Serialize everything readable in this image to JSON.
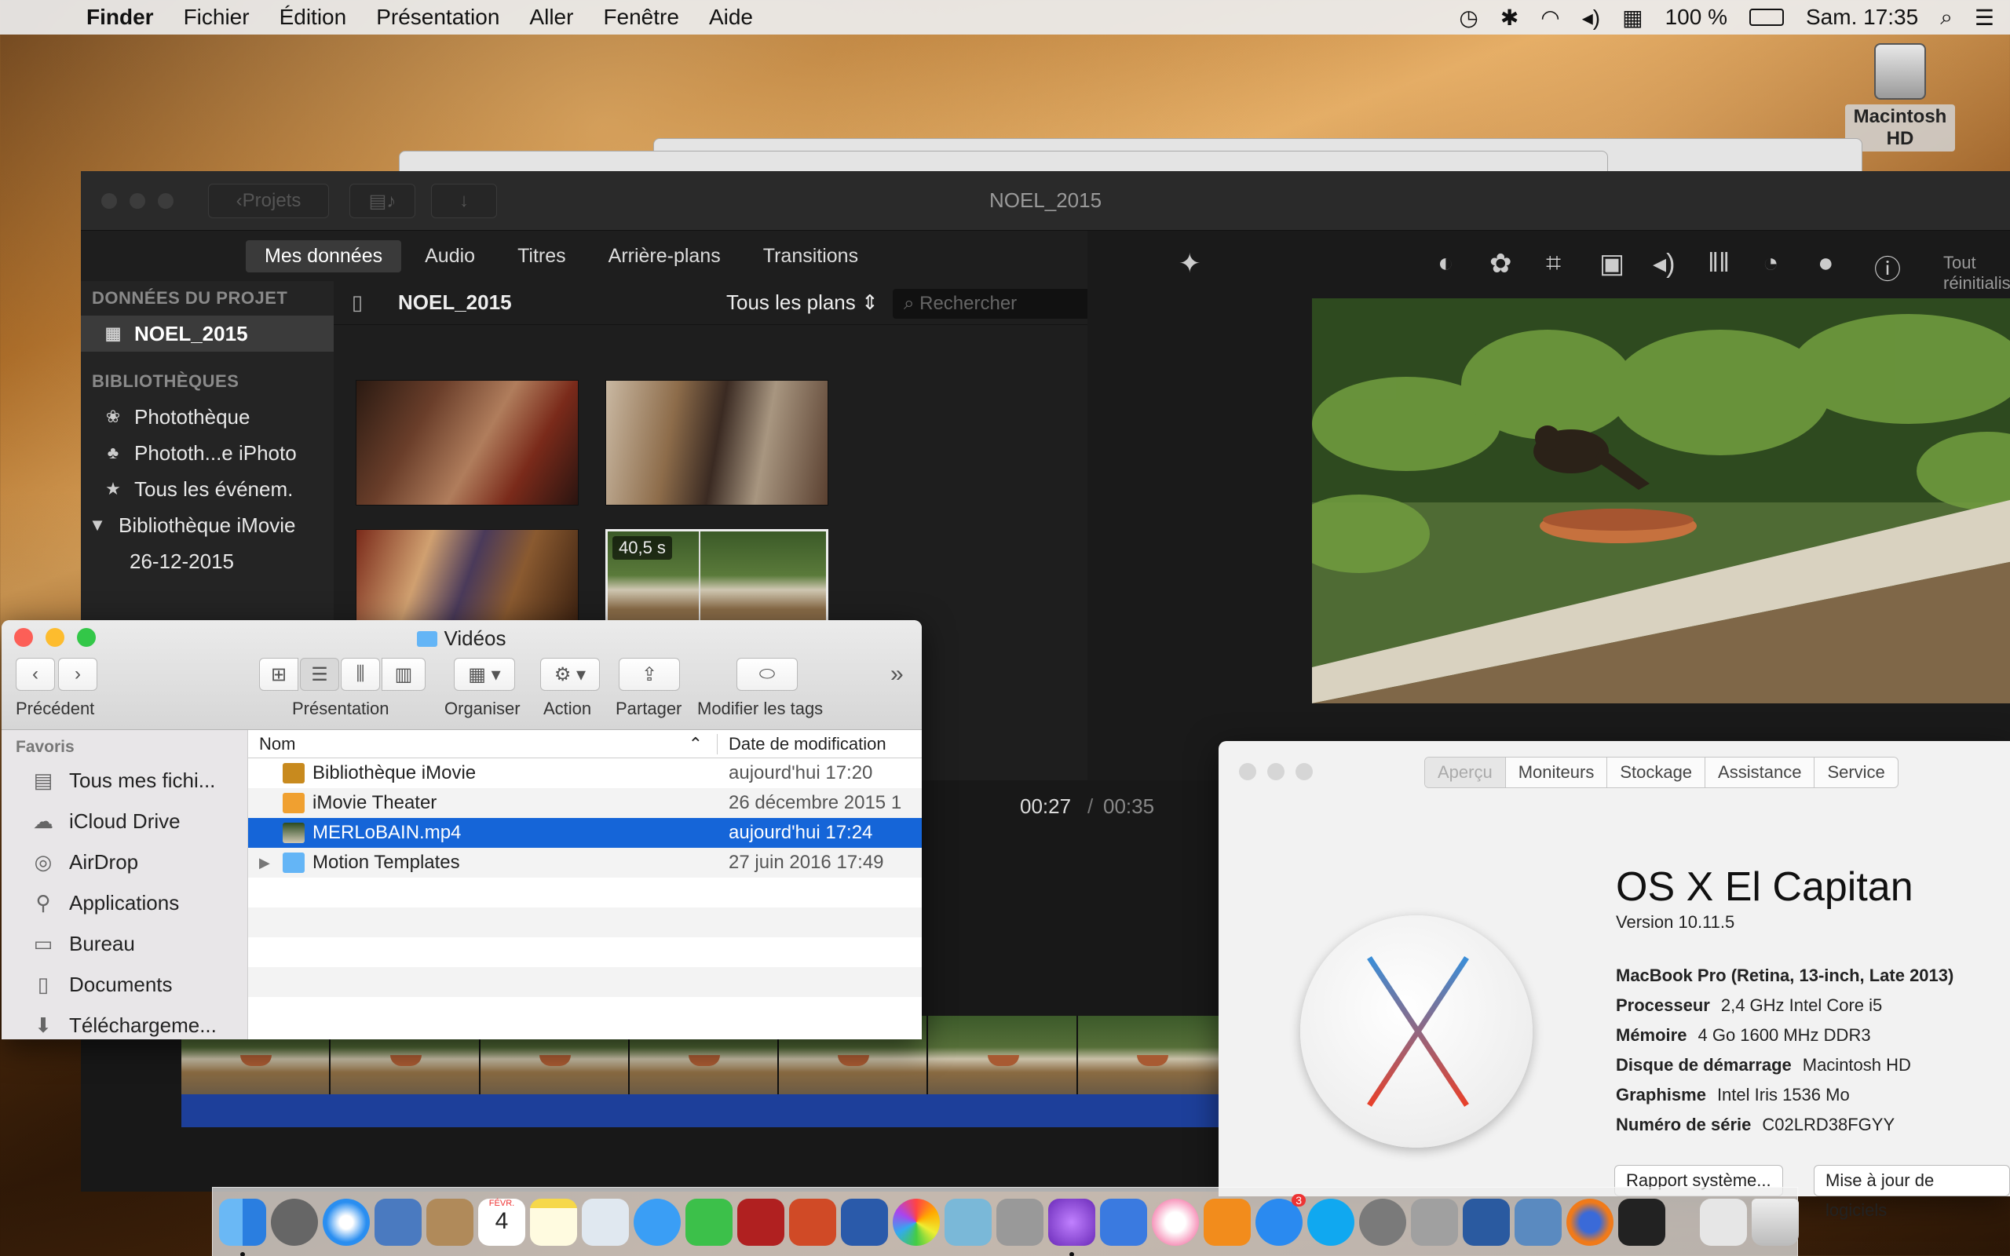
{
  "menubar": {
    "items": [
      "Finder",
      "Fichier",
      "Édition",
      "Présentation",
      "Aller",
      "Fenêtre",
      "Aide"
    ],
    "battery": "100 %",
    "clock": "Sam. 17:35"
  },
  "desktop": {
    "hd_label": "Macintosh HD"
  },
  "imovie": {
    "title": "NOEL_2015",
    "back_button": "Projets",
    "tabs": [
      "Mes données",
      "Audio",
      "Titres",
      "Arrière-plans",
      "Transitions"
    ],
    "sidebar": {
      "project_header": "DONNÉES DU PROJET",
      "project_item": "NOEL_2015",
      "libraries_header": "BIBLIOTHÈQUES",
      "libraries": [
        "Photothèque",
        "Phototh...e iPhoto",
        "Tous les événem.",
        "Bibliothèque iMovie",
        "26-12-2015"
      ]
    },
    "browser": {
      "title": "NOEL_2015",
      "filter": "Tous les plans",
      "search_placeholder": "Rechercher",
      "clip_duration": "40,5 s"
    },
    "viewer": {
      "reset": "Tout réinitialiser"
    },
    "playback": {
      "current": "00:27",
      "separator": "/",
      "total": "00:35"
    }
  },
  "finder": {
    "title": "Vidéos",
    "toolbar": {
      "back_label": "Précédent",
      "view_label": "Présentation",
      "arrange_label": "Organiser",
      "action_label": "Action",
      "share_label": "Partager",
      "tags_label": "Modifier les tags"
    },
    "sidebar": {
      "header": "Favoris",
      "items": [
        "Tous mes fichi...",
        "iCloud Drive",
        "AirDrop",
        "Applications",
        "Bureau",
        "Documents",
        "Téléchargeme..."
      ]
    },
    "columns": {
      "name": "Nom",
      "date": "Date de modification"
    },
    "rows": [
      {
        "name": "Bibliothèque iMovie",
        "date": "aujourd'hui 17:20"
      },
      {
        "name": "iMovie Theater",
        "date": "26 décembre 2015 1"
      },
      {
        "name": "MERLoBAIN.mp4",
        "date": "aujourd'hui 17:24"
      },
      {
        "name": "Motion Templates",
        "date": "27 juin 2016 17:49"
      }
    ]
  },
  "about": {
    "tabs": [
      "Aperçu",
      "Moniteurs",
      "Stockage",
      "Assistance",
      "Service"
    ],
    "os_name": "OS X El Capitan",
    "version": "Version 10.11.5",
    "model": "MacBook Pro (Retina, 13-inch, Late 2013)",
    "cpu_label": "Processeur",
    "cpu": "2,4 GHz Intel Core i5",
    "mem_label": "Mémoire",
    "mem": "4 Go 1600 MHz DDR3",
    "disk_label": "Disque de démarrage",
    "disk": "Macintosh HD",
    "gpu_label": "Graphisme",
    "gpu": "Intel Iris 1536 Mo",
    "serial_label": "Numéro de série",
    "serial": "C02LRD38FGYY",
    "btn_report": "Rapport système...",
    "btn_update": "Mise à jour de logiciels"
  },
  "dock": {
    "calendar_month": "FÉVR.",
    "calendar_day": "4",
    "appstore_badge": "3"
  }
}
